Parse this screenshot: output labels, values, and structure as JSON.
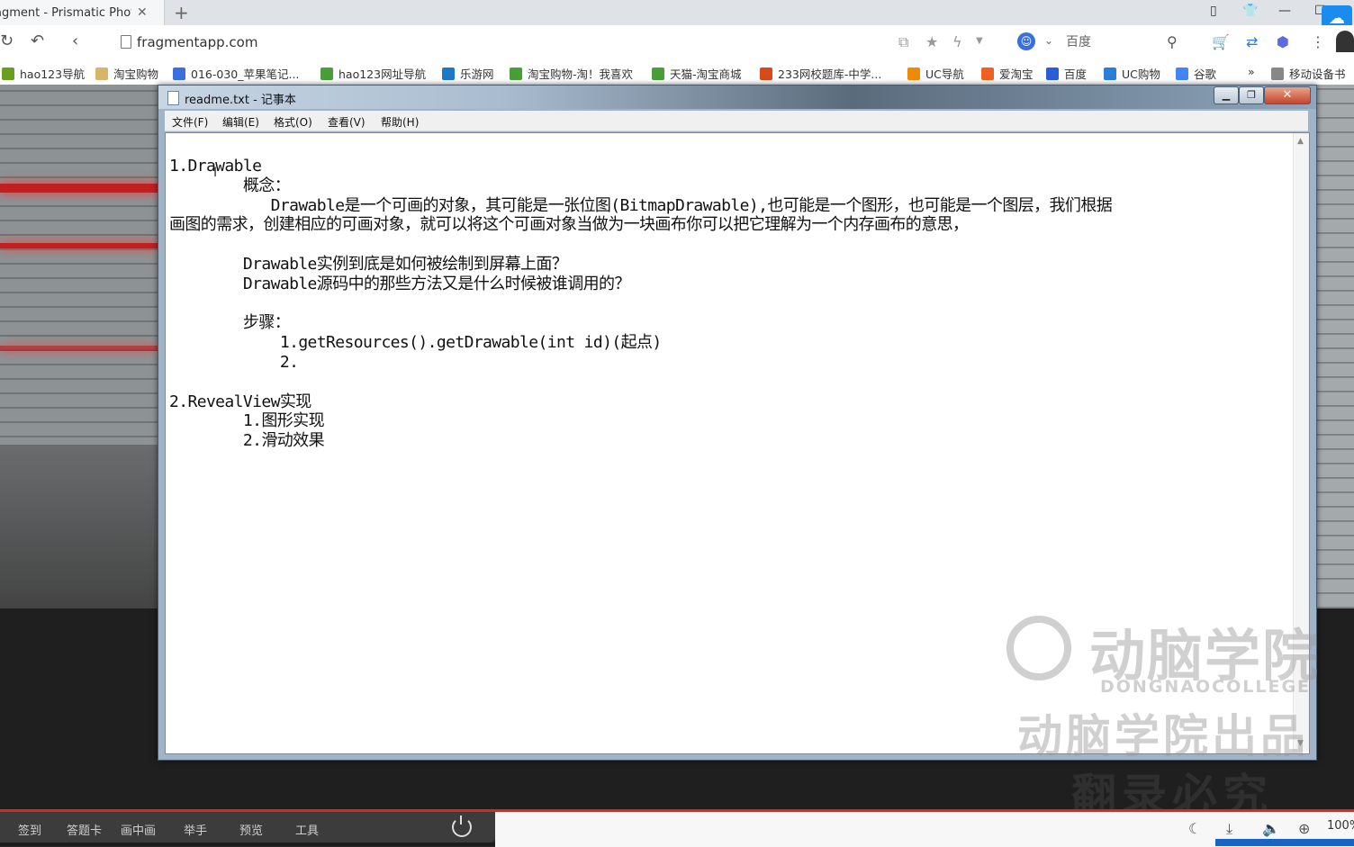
{
  "browser": {
    "tab_title": "agment - Prismatic Photo",
    "tab_close": "✕",
    "new_tab": "+",
    "url": "fragmentapp.com",
    "search_engine": "百度",
    "window_controls": [
      "minimize",
      "restore",
      "close"
    ]
  },
  "bookmarks": [
    {
      "label": "hao123导航",
      "icon": "bird-icon",
      "color": "#6a9e1f"
    },
    {
      "label": "淘宝购物",
      "icon": "folder-icon",
      "color": "#d8b56a"
    },
    {
      "label": "016-030_苹果笔记...",
      "icon": "play-icon",
      "color": "#3a6fe0"
    },
    {
      "label": "hao123网址导航",
      "icon": "house-icon",
      "color": "#4a9e3a"
    },
    {
      "label": "乐游网",
      "icon": "game-icon",
      "color": "#1e78c8"
    },
    {
      "label": "淘宝购物-淘！我喜欢",
      "icon": "house-icon",
      "color": "#4a9e3a"
    },
    {
      "label": "天猫-淘宝商城",
      "icon": "house-icon",
      "color": "#4a9e3a"
    },
    {
      "label": "233网校题库-中学...",
      "icon": "book-icon",
      "color": "#d84a1a"
    },
    {
      "label": "UC导航",
      "icon": "uc-icon",
      "color": "#f08a00"
    },
    {
      "label": "爱淘宝",
      "icon": "taobao-icon",
      "color": "#f06020"
    },
    {
      "label": "百度",
      "icon": "paw-icon",
      "color": "#2a5ed8"
    },
    {
      "label": "UC购物",
      "icon": "cart-icon",
      "color": "#2a7ed8"
    },
    {
      "label": "谷歌",
      "icon": "google-icon",
      "color": "#4285f4"
    },
    {
      "label": "»",
      "icon": "",
      "color": ""
    },
    {
      "label": "移动设备书",
      "icon": "phone-icon",
      "color": "#888888"
    }
  ],
  "notepad": {
    "title": "readme.txt - 记事本",
    "menus": [
      "文件(F)",
      "编辑(E)",
      "格式(O)",
      "查看(V)",
      "帮助(H)"
    ],
    "content": "1.Drawable\n        概念：\n           Drawable是一个可画的对象，其可能是一张位图(BitmapDrawable),也可能是一个图形，也可能是一个图层，我们根据\n画图的需求，创建相应的可画对象，就可以将这个可画对象当做为一块画布你可以把它理解为一个内存画布的意思，\n\n        Drawable实例到底是如何被绘制到屏幕上面？\n        Drawable源码中的那些方法又是什么时候被谁调用的？\n\n        步骤：\n            1.getResources().getDrawable(int id)(起点)\n            2.\n\n2.RevealView实现\n        1.图形实现\n        2.滑动效果"
  },
  "watermark": {
    "brand": "动脑学院",
    "sub": "DONGNAOCOLLEGE",
    "line2": "动脑学院出品",
    "line3": "翻录必究"
  },
  "player": {
    "buttons": [
      "签到",
      "答题卡",
      "画中画",
      "举手",
      "预览",
      "工具"
    ]
  },
  "statusbar": {
    "zoom": "100%"
  },
  "colors": {
    "accent_red": "#d42a1f",
    "status_blue": "#1864c6"
  }
}
